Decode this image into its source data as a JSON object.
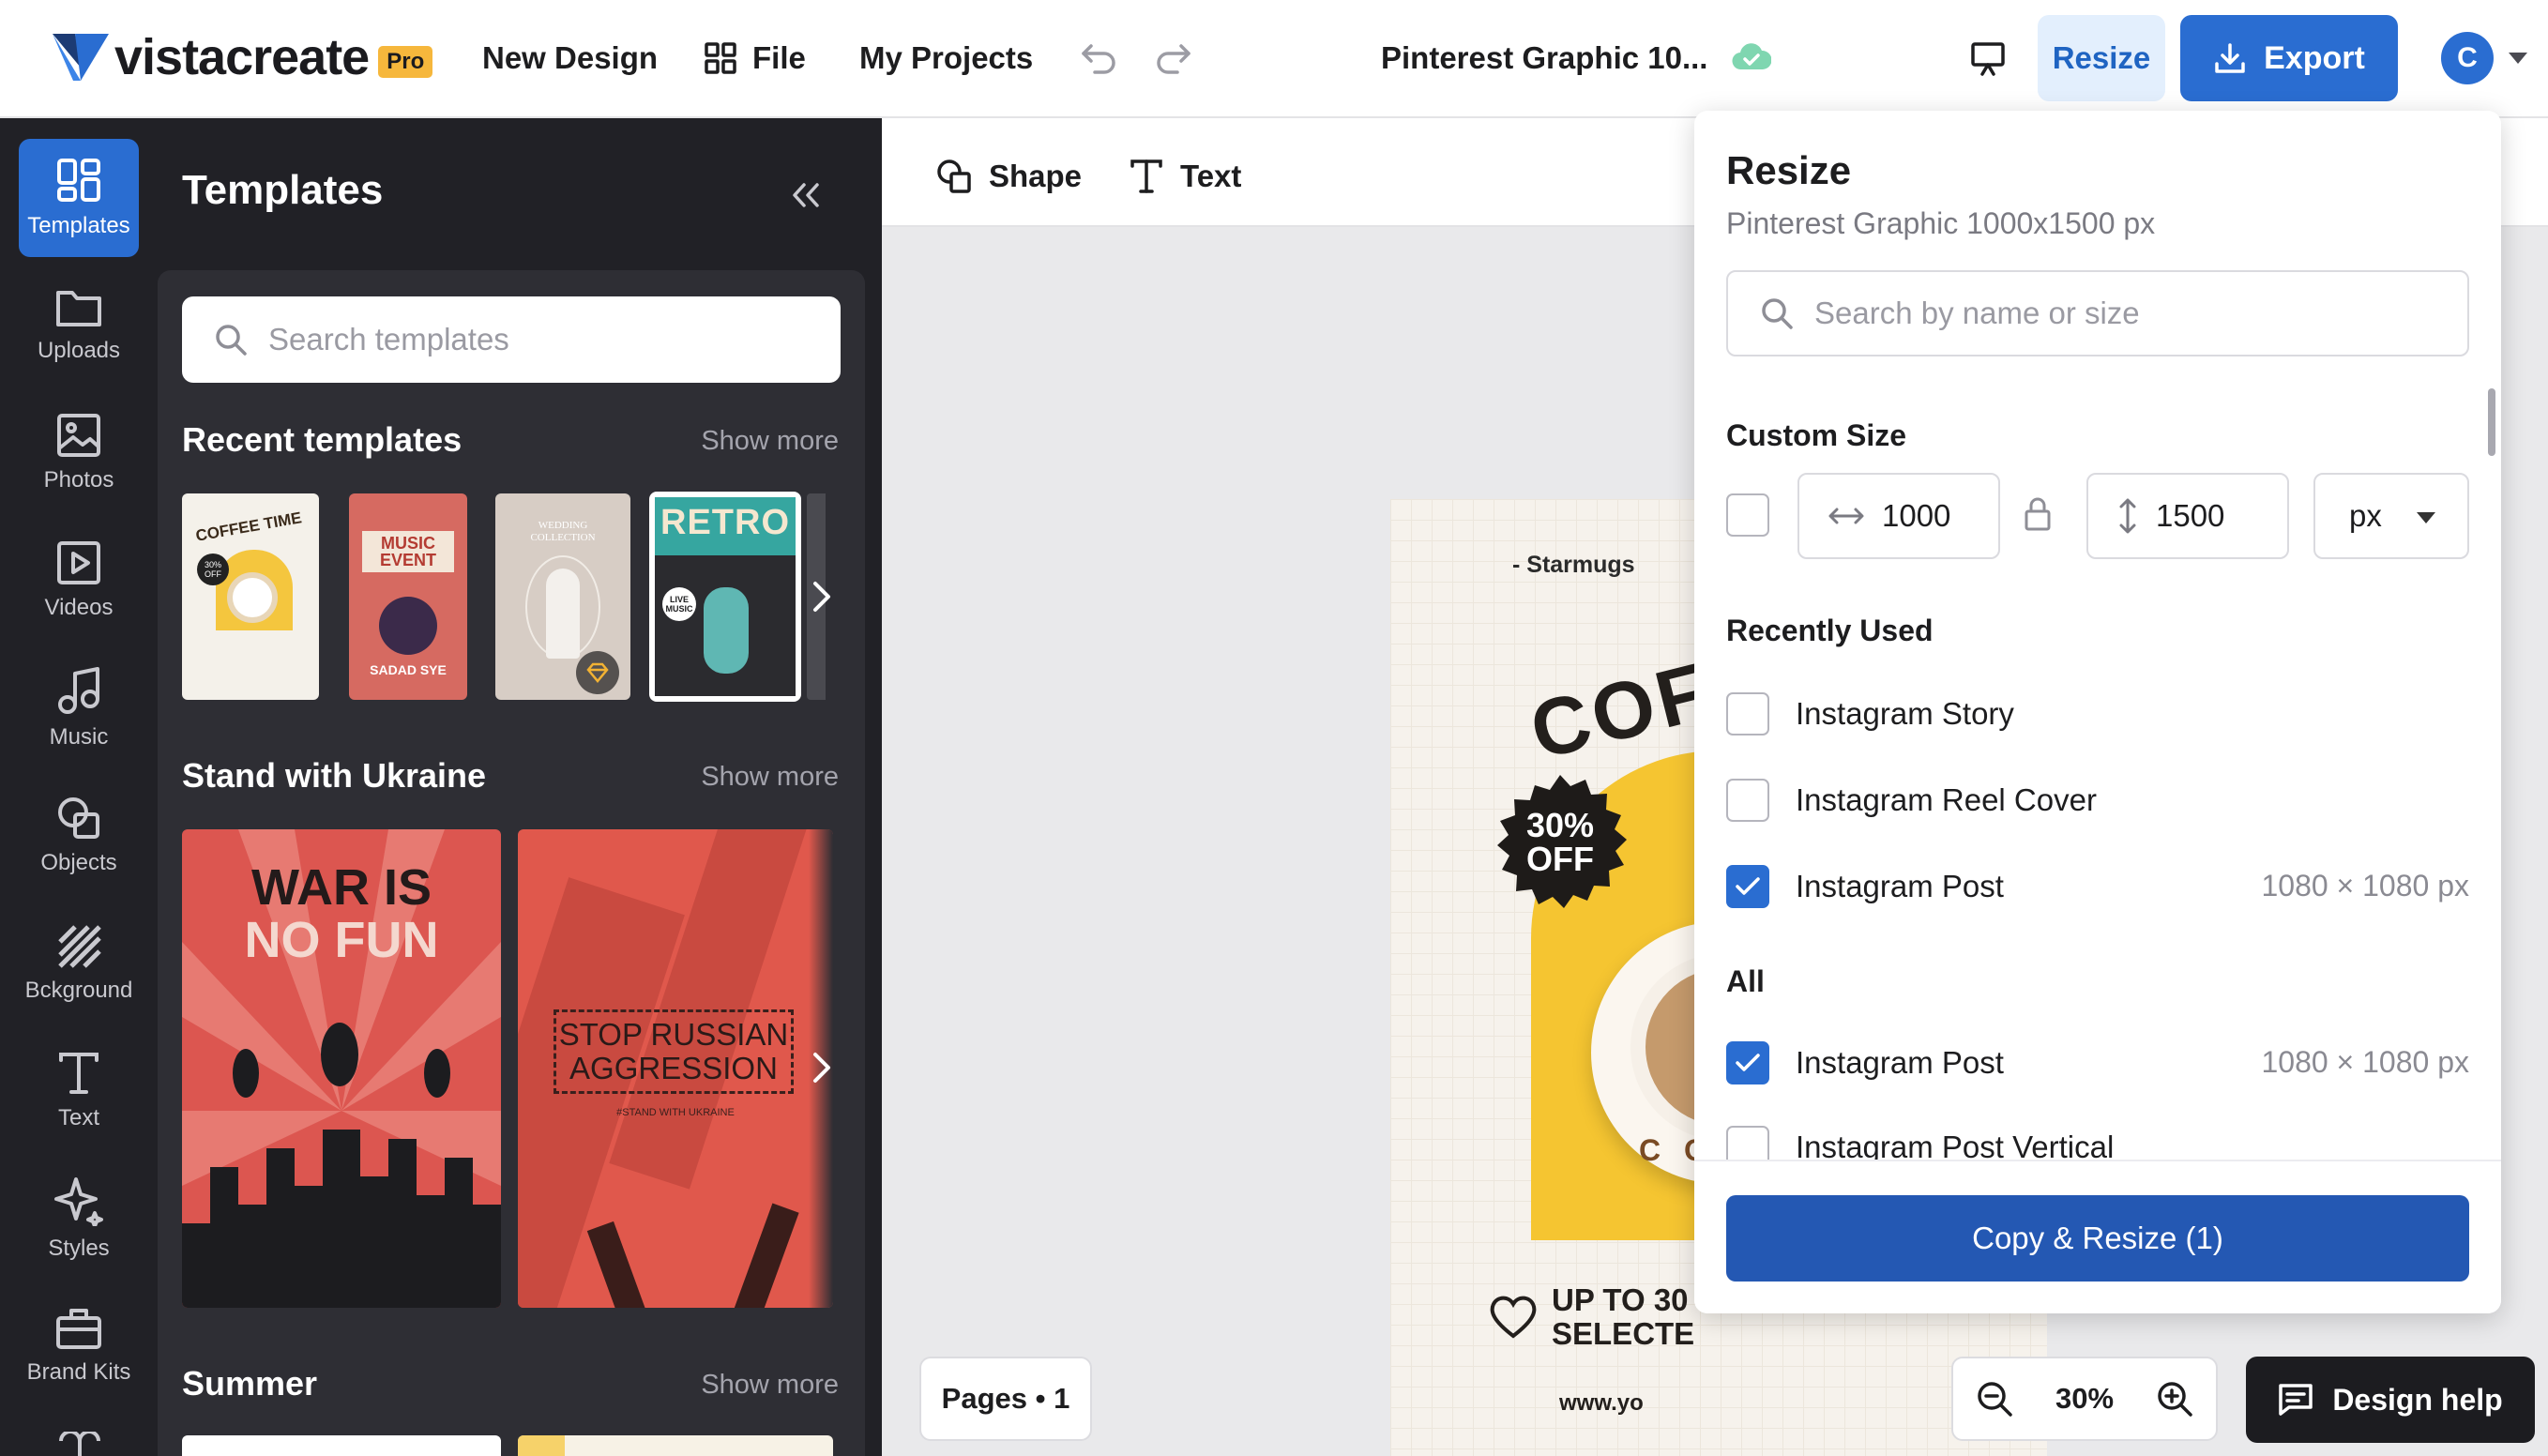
{
  "app": {
    "logo_text": "vistacreate",
    "pro_label": "Pro"
  },
  "topbar": {
    "new_design": "New Design",
    "file": "File",
    "my_projects": "My Projects",
    "doc_title": "Pinterest Graphic 10...",
    "resize": "Resize",
    "export": "Export",
    "avatar_initial": "C"
  },
  "rail": {
    "items": [
      {
        "label": "Templates",
        "icon": "templates-icon"
      },
      {
        "label": "Uploads",
        "icon": "folder-icon"
      },
      {
        "label": "Photos",
        "icon": "photo-icon"
      },
      {
        "label": "Videos",
        "icon": "video-icon"
      },
      {
        "label": "Music",
        "icon": "music-icon"
      },
      {
        "label": "Objects",
        "icon": "objects-icon"
      },
      {
        "label": "Bckground",
        "icon": "background-icon"
      },
      {
        "label": "Text",
        "icon": "text-icon"
      },
      {
        "label": "Styles",
        "icon": "styles-icon"
      },
      {
        "label": "Brand Kits",
        "icon": "brand-kits-icon"
      }
    ]
  },
  "templates_panel": {
    "title": "Templates",
    "search_placeholder": "Search templates",
    "sections": [
      {
        "title": "Recent templates",
        "show_more": "Show more"
      },
      {
        "title": "Stand with Ukraine",
        "show_more": "Show more"
      },
      {
        "title": "Summer",
        "show_more": "Show more"
      }
    ],
    "recent": [
      {
        "text1": "COFFEE TIME",
        "badge": "30% OFF"
      },
      {
        "text1": "MUSIC",
        "text2": "EVENT",
        "text3": "SADAD SYE"
      },
      {
        "text1": "WEDDING",
        "text2": "COLLECTION"
      },
      {
        "text1": "RETRO",
        "text2": "LIVE MUSIC"
      }
    ],
    "ukraine": [
      {
        "line1": "WAR IS",
        "line2": "NO FUN"
      },
      {
        "line1": "STOP RUSSIAN",
        "line2": "AGGRESSION",
        "line3": "#STAND WITH UKRAINE"
      }
    ]
  },
  "toolbar": {
    "shape": "Shape",
    "text": "Text"
  },
  "artboard": {
    "brand": "- Starmugs",
    "headline": "COFFE",
    "badge_line1": "30%",
    "badge_line2": "OFF",
    "promo_line1": "UP TO 30",
    "promo_line2": "SELECTE",
    "url": "www.yo",
    "cup_letters": "C O"
  },
  "canvas_footer": {
    "pages": "Pages • 1",
    "zoom": "30%",
    "design_help": "Design help"
  },
  "resize_panel": {
    "title": "Resize",
    "subtitle": "Pinterest Graphic 1000x1500 px",
    "search_placeholder": "Search by name or size",
    "custom_size_label": "Custom Size",
    "width": "1000",
    "height": "1500",
    "unit": "px",
    "recently_used_label": "Recently Used",
    "recently_used": [
      {
        "label": "Instagram Story",
        "size": "",
        "checked": false
      },
      {
        "label": "Instagram Reel Cover",
        "size": "",
        "checked": false
      },
      {
        "label": "Instagram Post",
        "size": "1080 × 1080 px",
        "checked": true
      }
    ],
    "all_label": "All",
    "all": [
      {
        "label": "Instagram Post",
        "size": "1080 × 1080 px",
        "checked": true
      },
      {
        "label": "Instagram Post Vertical",
        "size": "",
        "checked": false
      }
    ],
    "copy_button": "Copy & Resize (1)"
  },
  "colors": {
    "accent": "#2a6dd1",
    "dark_panel": "#212126",
    "resize_highlight": "#e3effd",
    "copy_button": "#2458b3"
  }
}
